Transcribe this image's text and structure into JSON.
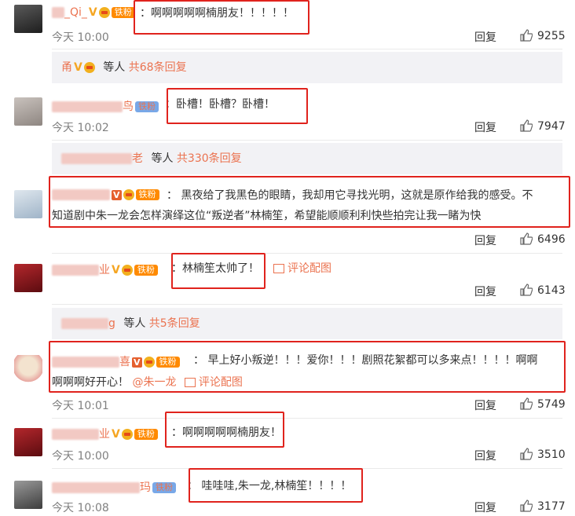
{
  "comments": [
    {
      "name_suffix": "_Qi_",
      "text": "：啊啊啊啊啊楠朋友！！！！！",
      "time": "今天 10:00",
      "reply": "回复",
      "likes": "9255"
    },
    {
      "name_suffix": "鸟",
      "fan": "铁粉",
      "text": "：卧槽！卧槽？卧槽！",
      "time": "今天 10:02",
      "reply": "回复",
      "likes": "7947"
    },
    {
      "fan": "铁粉",
      "text_line1": "：  黑夜给了我黑色的眼睛，我却用它寻找光明，这就是原作给我的感受。不",
      "text_line2": "知道剧中朱一龙会怎样演绎这位“叛逆者”林楠笙，希望能顺顺利利快些拍完让我一睹为快",
      "reply": "回复",
      "likes": "6496"
    },
    {
      "name_suffix": "业",
      "fan": "铁粉",
      "text": "：林楠笙太帅了！",
      "pic_link": "评论配图",
      "reply": "回复",
      "likes": "6143"
    },
    {
      "name_suffix": "喜",
      "fan": "铁粉",
      "text_line1": "：  早上好小叛逆！！！爱你！！！剧照花絮都可以多来点！！！！啊啊",
      "text_line2_a": "啊啊啊好开心！",
      "mention": "@朱一龙",
      "pic_link": "评论配图",
      "time": "今天 10:01",
      "reply": "回复",
      "likes": "5749"
    },
    {
      "name_suffix": "业",
      "fan": "铁粉",
      "text": "：啊啊啊啊啊楠朋友！",
      "time": "今天 10:00",
      "reply": "回复",
      "likes": "3510"
    },
    {
      "name_suffix": "玛",
      "fan": "铁粉",
      "text": "：  哇哇哇,朱一龙,林楠笙！！！！",
      "time": "今天 10:08",
      "reply": "回复",
      "likes": "3177"
    }
  ],
  "subthreads": [
    {
      "name_suffix": "甬",
      "others": "等人",
      "count": "共68条回复"
    },
    {
      "name_suffix": "老",
      "others": "等人",
      "count": "共330条回复"
    },
    {
      "name_suffix": "g",
      "others": "等人",
      "count": "共5条回复"
    }
  ],
  "colors": {
    "accent": "#eb7350",
    "highlight_box": "#e0231d",
    "sub_bg": "#f2f2f5"
  }
}
